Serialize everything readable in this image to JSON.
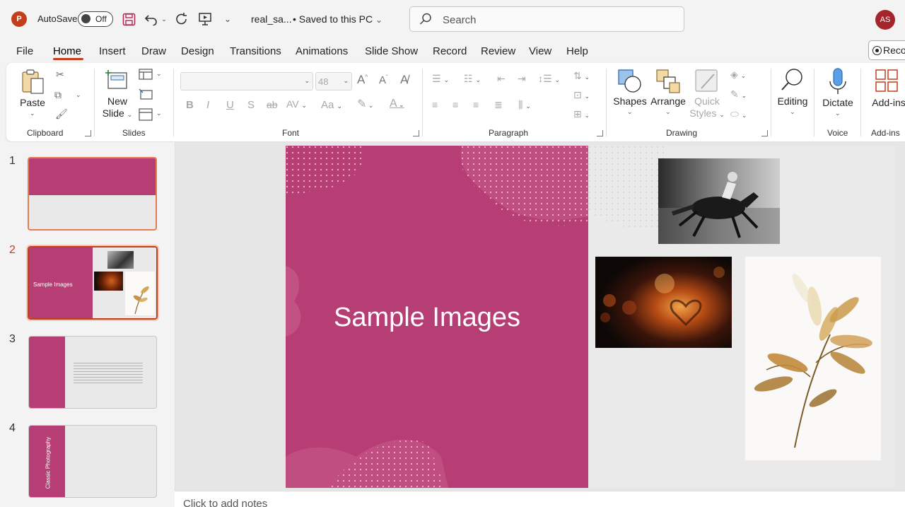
{
  "titlebar": {
    "autosave_label": "AutoSave",
    "autosave_state": "Off",
    "document_name": "real_sa...",
    "save_status": "• Saved to this PC",
    "search_placeholder": "Search",
    "user_initials": "AS"
  },
  "tabs": [
    "File",
    "Home",
    "Insert",
    "Draw",
    "Design",
    "Transitions",
    "Animations",
    "Slide Show",
    "Record",
    "Review",
    "View",
    "Help"
  ],
  "active_tab": "Home",
  "record_button": "Reco",
  "ribbon": {
    "clipboard": {
      "paste_label": "Paste",
      "group_label": "Clipboard"
    },
    "slides": {
      "new_slide_label_1": "New",
      "new_slide_label_2": "Slide",
      "group_label": "Slides"
    },
    "font": {
      "font_name": "",
      "font_size": "48",
      "group_label": "Font"
    },
    "paragraph": {
      "group_label": "Paragraph"
    },
    "drawing": {
      "shapes_label": "Shapes",
      "arrange_label": "Arrange",
      "quick_styles_label_1": "Quick",
      "quick_styles_label_2": "Styles",
      "group_label": "Drawing"
    },
    "editing": {
      "label": "Editing"
    },
    "voice": {
      "dictate_label": "Dictate",
      "group_label": "Voice"
    },
    "addins": {
      "label": "Add-ins",
      "group_label": "Add-ins"
    }
  },
  "thumbnails": [
    {
      "number": "1"
    },
    {
      "number": "2",
      "title": "Sample Images"
    },
    {
      "number": "3"
    },
    {
      "number": "4",
      "title": "Classic Photography"
    }
  ],
  "slide": {
    "title": "Sample Images",
    "accent_color": "#b73e74"
  },
  "notes_placeholder": "Click to add notes",
  "colors": {
    "brand": "#c43e1c",
    "slide_accent": "#b73e74"
  }
}
